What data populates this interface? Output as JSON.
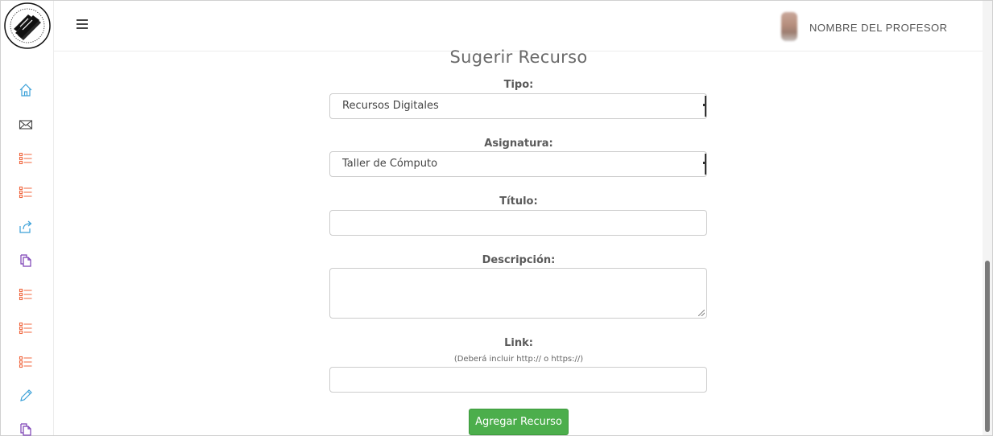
{
  "header": {
    "professor_name": "NOMBRE DEL PROFESOR",
    "menu_icon": "hamburger-icon",
    "avatar_icon": "user-avatar"
  },
  "sidebar": {
    "logo": "school-logo",
    "items": [
      {
        "icon": "home-icon",
        "color": "#3aa0d8"
      },
      {
        "icon": "mail-icon",
        "color": "#444444"
      },
      {
        "icon": "list-icon",
        "color": "#f0643c"
      },
      {
        "icon": "list-icon",
        "color": "#f0643c"
      },
      {
        "icon": "share-icon",
        "color": "#3aa0d8"
      },
      {
        "icon": "copy-icon",
        "color": "#7b3fb5"
      },
      {
        "icon": "list-icon",
        "color": "#f0643c"
      },
      {
        "icon": "list-icon",
        "color": "#f0643c"
      },
      {
        "icon": "list-icon",
        "color": "#f0643c"
      },
      {
        "icon": "pencil-icon",
        "color": "#3aa0d8"
      },
      {
        "icon": "copy-icon",
        "color": "#7b3fb5"
      }
    ]
  },
  "form": {
    "title": "Sugerir Recurso",
    "tipo": {
      "label": "Tipo:",
      "value": "Recursos Digitales"
    },
    "asignatura": {
      "label": "Asignatura:",
      "value": "Taller de Cómputo"
    },
    "titulo": {
      "label": "Título:",
      "value": ""
    },
    "descripcion": {
      "label": "Descripción:",
      "value": ""
    },
    "link": {
      "label": "Link:",
      "hint": "(Deberá incluir http:// o https://)",
      "value": ""
    },
    "submit_label": "Agregar Recurso"
  },
  "colors": {
    "accent_green": "#4cae4c",
    "icon_blue": "#3aa0d8",
    "icon_orange": "#f0643c",
    "icon_purple": "#7b3fb5"
  }
}
